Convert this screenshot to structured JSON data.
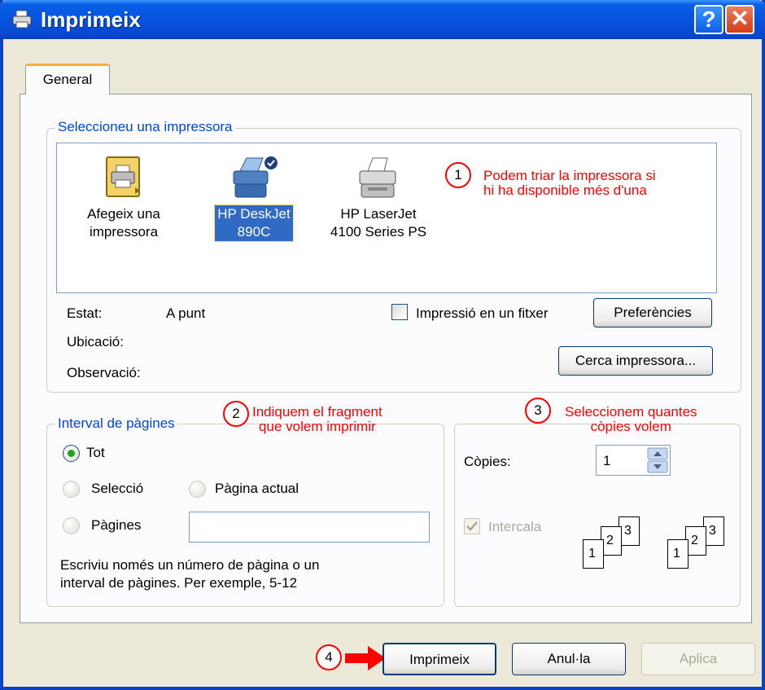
{
  "window": {
    "title": "Imprimeix",
    "help_label": "?",
    "close_label": "✕"
  },
  "tabs": [
    {
      "label": "General"
    }
  ],
  "printer_group": {
    "legend": "Seleccioneu una impressora",
    "printers": [
      {
        "line1": "Afegeix una",
        "line2": "impressora",
        "icon": "add-printer-icon",
        "selected": false
      },
      {
        "line1": "HP DeskJet",
        "line2": "890C",
        "icon": "default-printer-icon",
        "selected": true
      },
      {
        "line1": "HP LaserJet",
        "line2": "4100 Series PS",
        "icon": "printer-icon",
        "selected": false
      }
    ],
    "status_label": "Estat:",
    "status_value": "A punt",
    "location_label": "Ubicació:",
    "comment_label": "Observació:",
    "print_to_file_label": "Impressió en un fitxer",
    "print_to_file_checked": false,
    "preferences_label": "Preferències",
    "find_printer_label": "Cerca impressora..."
  },
  "page_range_group": {
    "legend": "Interval de pàgines",
    "all_label": "Tot",
    "selection_label": "Selecció",
    "current_page_label": "Pàgina actual",
    "pages_label": "Pàgines",
    "pages_value": "",
    "selected": "all",
    "help_line1": "Escriviu només un número de pàgina o un",
    "help_line2": "interval de pàgines. Per exemple, 5-12"
  },
  "copies_group": {
    "copies_label": "Còpies:",
    "copies_value": "1",
    "collate_label": "Intercala",
    "collate_checked": true,
    "collate_pages": [
      "1",
      "2",
      "3"
    ]
  },
  "buttons": {
    "print_label": "Imprimeix",
    "cancel_label": "Anul·la",
    "apply_label": "Aplica"
  },
  "annotations": [
    {
      "number": "1",
      "line1": "Podem triar la impressora si",
      "line2": "hi ha disponible més d'una"
    },
    {
      "number": "2",
      "line1": "Indiquem el fragment",
      "line2": "que volem imprimir"
    },
    {
      "number": "3",
      "line1": "Seleccionem quantes",
      "line2": "còpies volem"
    },
    {
      "number": "4"
    }
  ],
  "colors": {
    "title_bar": "#0553e0",
    "accent": "#0046d5",
    "annotation": "#ff0000",
    "selection": "#316ac5"
  }
}
